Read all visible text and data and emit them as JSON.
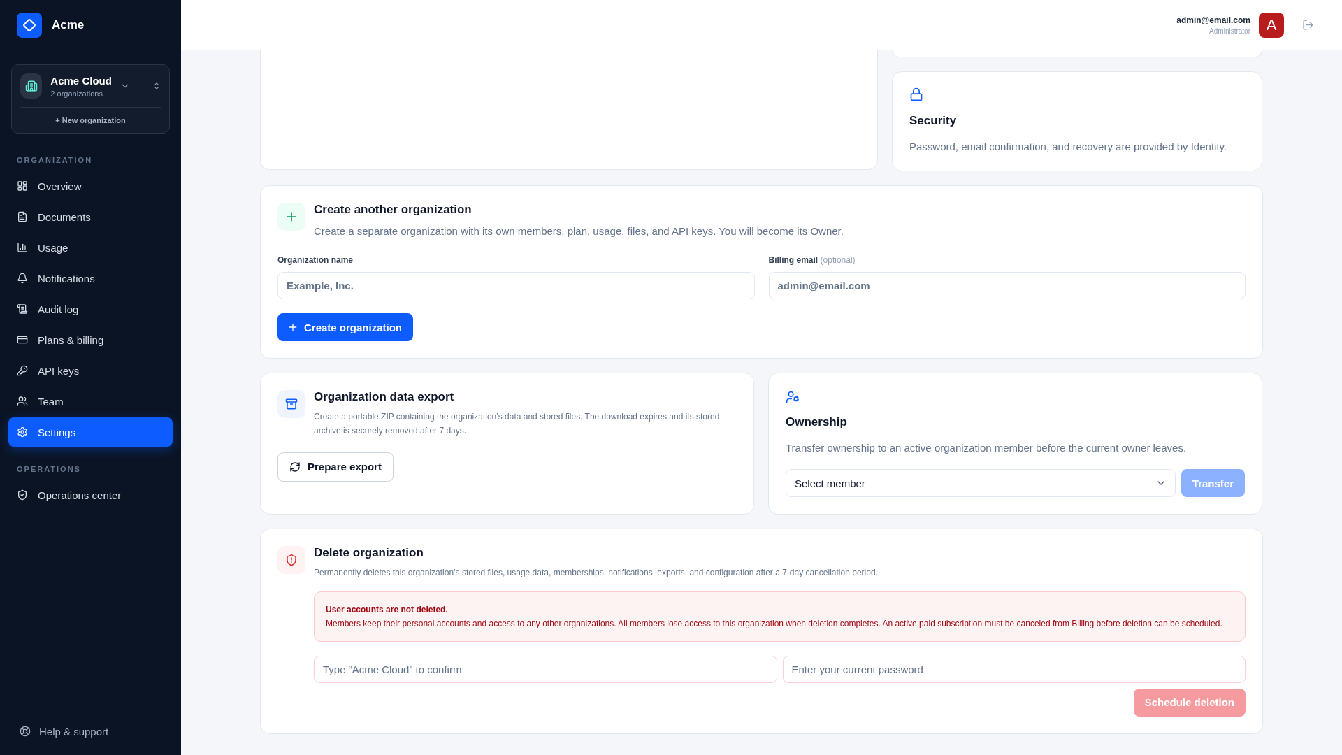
{
  "brand": {
    "name": "Acme"
  },
  "org_switcher": {
    "name": "Acme Cloud",
    "count": "2 organizations",
    "new_link": "+ New organization"
  },
  "nav_sections": [
    {
      "title": "ORGANIZATION",
      "items": [
        {
          "label": "Overview",
          "selected": false
        },
        {
          "label": "Documents",
          "selected": false
        },
        {
          "label": "Usage",
          "selected": false
        },
        {
          "label": "Notifications",
          "selected": false
        },
        {
          "label": "Audit log",
          "selected": false
        },
        {
          "label": "Plans & billing",
          "selected": false
        },
        {
          "label": "API keys",
          "selected": false
        },
        {
          "label": "Team",
          "selected": false
        },
        {
          "label": "Settings",
          "selected": true
        }
      ]
    },
    {
      "title": "OPERATIONS",
      "items": [
        {
          "label": "Operations center",
          "selected": false
        }
      ]
    }
  ],
  "help_link": "Help & support",
  "user": {
    "email": "admin@email.com",
    "role": "Administrator",
    "avatar": "A"
  },
  "security": {
    "title": "Security",
    "text": "Password, email confirmation, and recovery are provided by Identity."
  },
  "create_org": {
    "title": "Create another organization",
    "text": "Create a separate organization with its own members, plan, usage, files, and API keys. You will become its Owner.",
    "name_label": "Organization name",
    "name_placeholder": "Example, Inc.",
    "email_label": "Billing email",
    "email_hint": "(optional)",
    "email_placeholder": "admin@email.com",
    "button": "Create organization"
  },
  "export": {
    "title": "Organization data export",
    "text": "Create a portable ZIP containing the organization’s data and stored files. The download expires and its stored archive is securely removed after 7 days.",
    "button": "Prepare export"
  },
  "ownership": {
    "title": "Ownership",
    "text": "Transfer ownership to an active organization member before the current owner leaves.",
    "select_value": "Select member",
    "button": "Transfer",
    "disabled": true
  },
  "delete_org": {
    "title": "Delete organization",
    "text": "Permanently deletes this organization’s stored files, usage data, memberships, notifications, exports, and configuration after a 7-day cancellation period.",
    "alert_title": "User accounts are not deleted.",
    "alert_text": "Members keep their personal accounts and access to any other organizations. All members lose access to this organization when deletion completes. An active paid subscription must be canceled from Billing before deletion can be scheduled.",
    "confirm_placeholder": "Type “Acme Cloud” to confirm",
    "password_placeholder": "Enter your current password",
    "button": "Schedule deletion",
    "disabled": true
  }
}
